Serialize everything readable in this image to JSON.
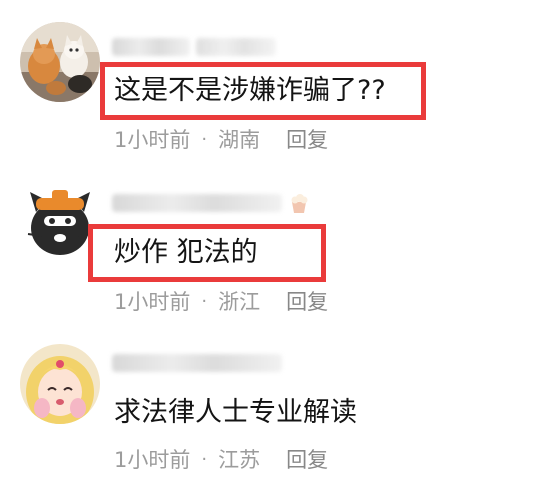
{
  "comments": [
    {
      "text": "这是不是涉嫌诈骗了??",
      "time": "1小时前",
      "separator": "·",
      "location": "湖南",
      "reply_label": "回复",
      "avatar_icon": "cats-photo-avatar",
      "highlighted": true
    },
    {
      "text": "炒作 犯法的",
      "time": "1小时前",
      "separator": "·",
      "location": "浙江",
      "reply_label": "回复",
      "avatar_icon": "black-cat-cartoon-avatar",
      "highlighted": true
    },
    {
      "text": "求法律人士专业解读",
      "time": "1小时前",
      "separator": "·",
      "location": "江苏",
      "reply_label": "回复",
      "avatar_icon": "anime-girl-avatar",
      "highlighted": false
    }
  ],
  "colors": {
    "highlight_border": "#ea3b3b",
    "meta_text": "#9c9c9c",
    "comment_text": "#141414"
  }
}
